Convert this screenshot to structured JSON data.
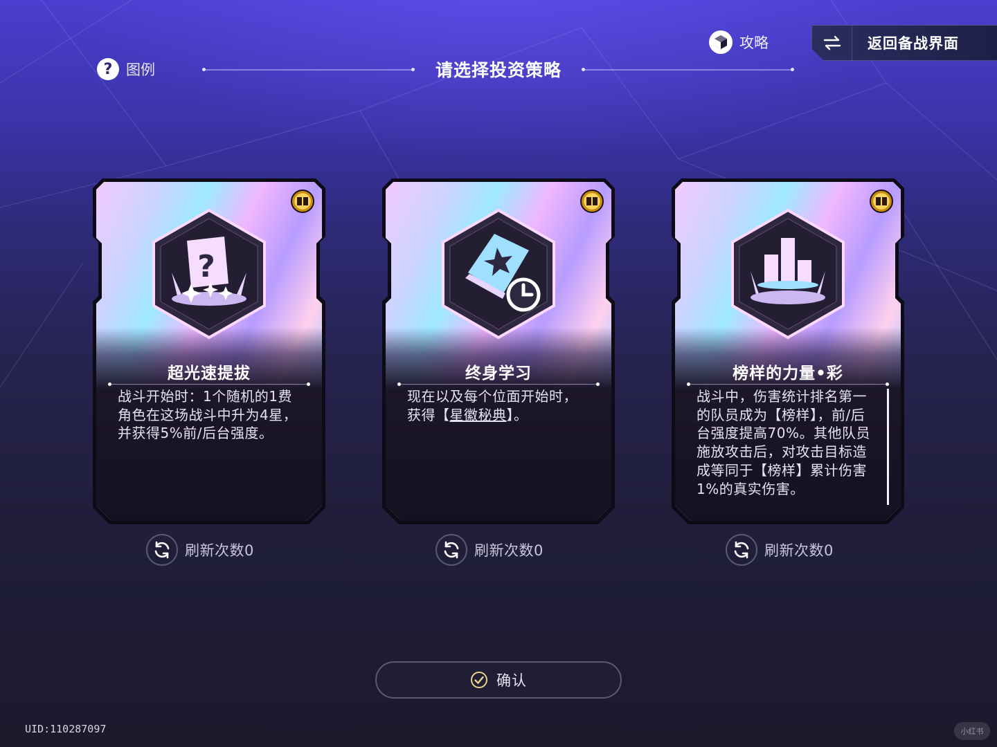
{
  "header": {
    "legend_label": "图例",
    "page_title": "请选择投资策略",
    "guide_label": "攻略",
    "back_label": "返回备战界面"
  },
  "cards": [
    {
      "title": "超光速提拔",
      "icon": "crown-question-card-icon",
      "description": "战斗开始时：1个随机的1费角色在这场战斗中升为4星，并获得5%前/后台强度。",
      "refresh_label": "刷新次数0"
    },
    {
      "title": "终身学习",
      "icon": "star-book-clock-icon",
      "description_prefix": "现在以及每个位面开始时，获得【",
      "description_link": "星徽秘典",
      "description_suffix": "】。",
      "refresh_label": "刷新次数0"
    },
    {
      "title": "榜样的力量•彩",
      "icon": "crown-bar-chart-icon",
      "description": "战斗中，伤害统计排名第一的队员成为【榜样】，前/后台强度提高70%。其他队员施放攻击后，对攻击目标造成等同于【榜样】累计伤害1%的真实伤害。",
      "refresh_label": "刷新次数0"
    }
  ],
  "footer": {
    "confirm_label": "确认",
    "uid": "UID:110287097",
    "watermark": "小红书"
  },
  "colors": {
    "badge_gold": "#ffd45a",
    "icon_glow": "#ffe6ff",
    "hex_border": "#ffd8ff"
  }
}
